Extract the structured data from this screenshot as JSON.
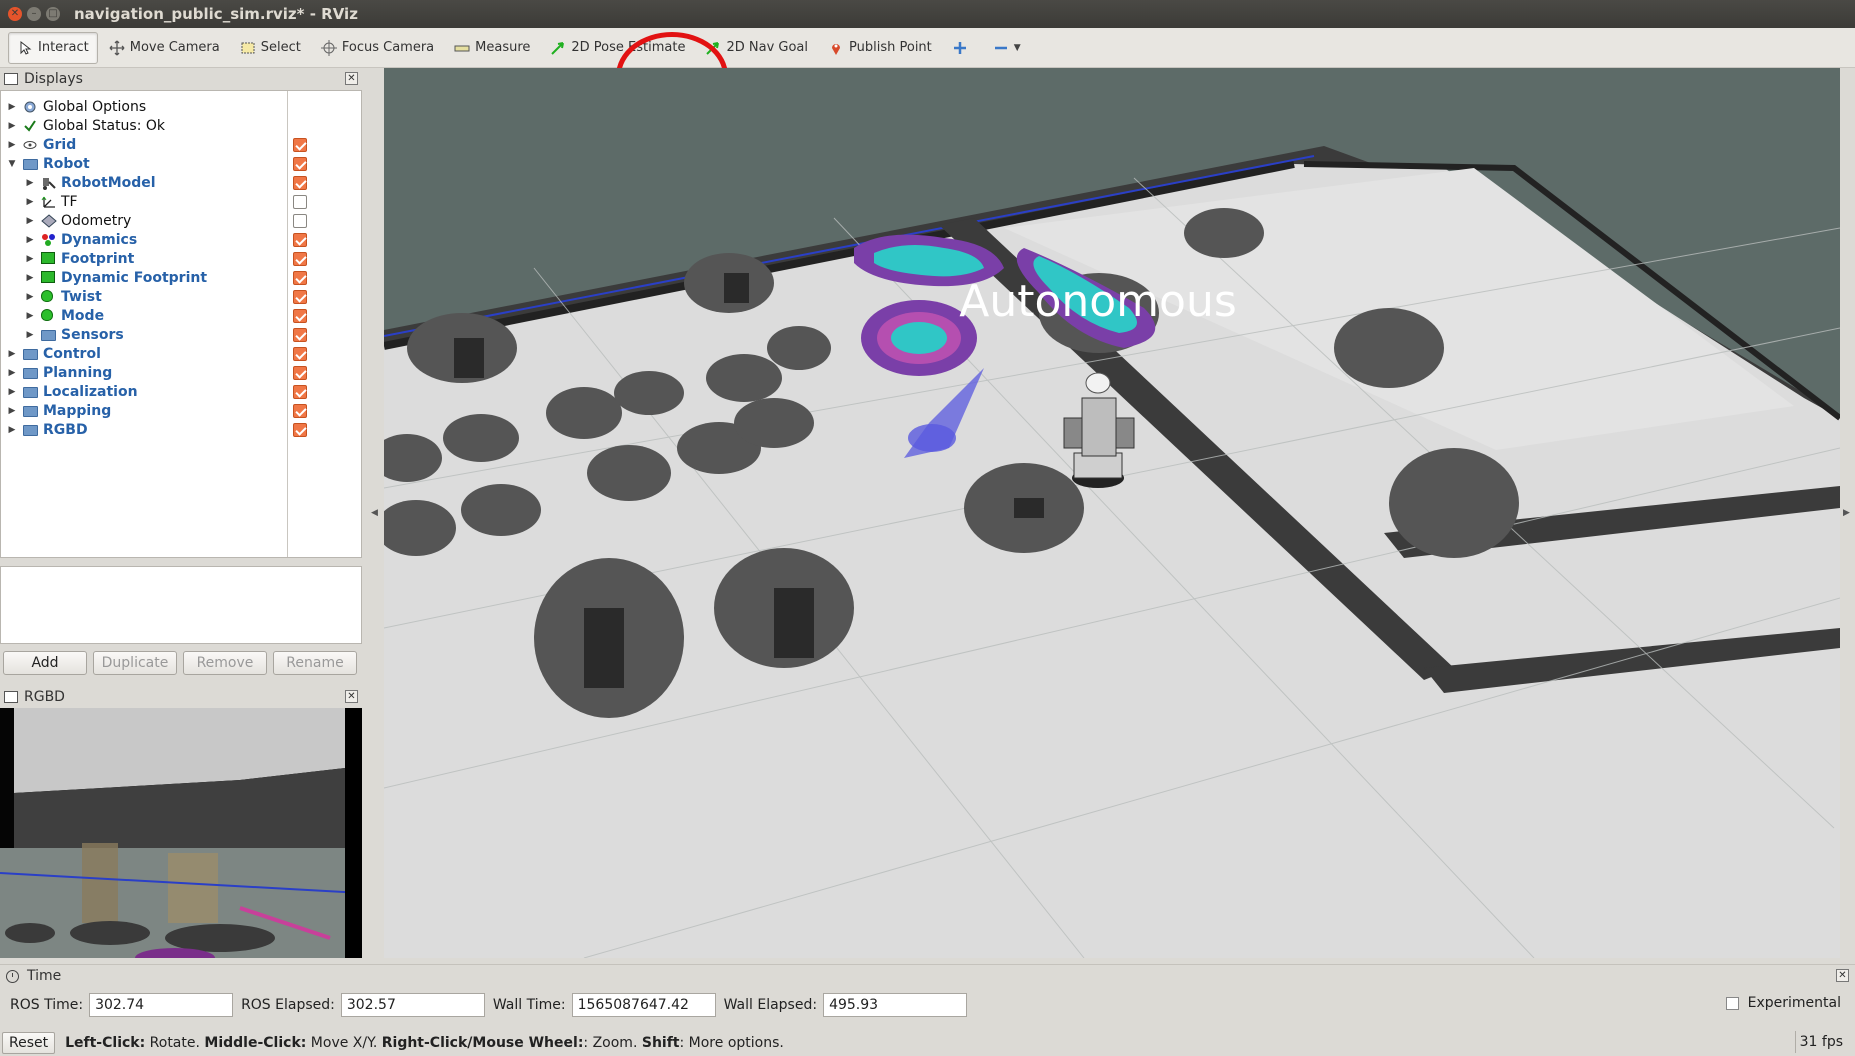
{
  "window": {
    "title": "navigation_public_sim.rviz* - RViz"
  },
  "toolbar": {
    "tools": [
      {
        "label": "Interact",
        "icon": "interact-cursor-icon",
        "active": true
      },
      {
        "label": "Move Camera",
        "icon": "move-camera-icon"
      },
      {
        "label": "Select",
        "icon": "select-box-icon"
      },
      {
        "label": "Focus Camera",
        "icon": "focus-crosshair-icon"
      },
      {
        "label": "Measure",
        "icon": "ruler-icon"
      },
      {
        "label": "2D Pose Estimate",
        "icon": "green-arrow-icon"
      },
      {
        "label": "2D Nav Goal",
        "icon": "green-arrow-icon"
      },
      {
        "label": "Publish Point",
        "icon": "map-pin-icon"
      }
    ],
    "highlight_color": "#e21212"
  },
  "displays": {
    "title": "Displays",
    "items": [
      {
        "label": "Global Options",
        "icon": "gear-icon",
        "bold": false,
        "checkbox": null
      },
      {
        "label": "Global Status: Ok",
        "icon": "checkmark-icon",
        "bold": false,
        "checkbox": null
      },
      {
        "label": "Grid",
        "icon": "grid-icon",
        "bold": true,
        "checkbox": true
      },
      {
        "label": "Robot",
        "icon": "folder-icon",
        "bold": true,
        "checkbox": true,
        "expanded": true
      },
      {
        "label": "RobotModel",
        "icon": "robot-model-icon",
        "bold": true,
        "checkbox": true
      },
      {
        "label": "TF",
        "icon": "tf-axes-icon",
        "bold": false,
        "checkbox": false
      },
      {
        "label": "Odometry",
        "icon": "odometry-icon",
        "bold": false,
        "checkbox": false
      },
      {
        "label": "Dynamics",
        "icon": "dynamics-icon",
        "bold": true,
        "checkbox": true
      },
      {
        "label": "Footprint",
        "icon": "footprint-icon",
        "bold": true,
        "checkbox": true
      },
      {
        "label": "Dynamic Footprint",
        "icon": "footprint-icon",
        "bold": true,
        "checkbox": true
      },
      {
        "label": "Twist",
        "icon": "twist-icon",
        "bold": true,
        "checkbox": true
      },
      {
        "label": "Mode",
        "icon": "mode-icon",
        "bold": true,
        "checkbox": true
      },
      {
        "label": "Sensors",
        "icon": "folder-icon",
        "bold": true,
        "checkbox": true
      },
      {
        "label": "Control",
        "icon": "folder-icon",
        "bold": true,
        "checkbox": true
      },
      {
        "label": "Planning",
        "icon": "folder-icon",
        "bold": true,
        "checkbox": true
      },
      {
        "label": "Localization",
        "icon": "folder-icon",
        "bold": true,
        "checkbox": true
      },
      {
        "label": "Mapping",
        "icon": "folder-icon",
        "bold": true,
        "checkbox": true
      },
      {
        "label": "RGBD",
        "icon": "folder-icon",
        "bold": true,
        "checkbox": true
      }
    ],
    "buttons": {
      "add": "Add",
      "duplicate": "Duplicate",
      "remove": "Remove",
      "rename": "Rename"
    }
  },
  "rgbd": {
    "title": "RGBD"
  },
  "viewport": {
    "overlay_text": "Autonomous"
  },
  "time": {
    "title": "Time",
    "ros_time_label": "ROS Time:",
    "ros_time": "302.74",
    "ros_elapsed_label": "ROS Elapsed:",
    "ros_elapsed": "302.57",
    "wall_time_label": "Wall Time:",
    "wall_time": "1565087647.42",
    "wall_elapsed_label": "Wall Elapsed:",
    "wall_elapsed": "495.93",
    "experimental_label": "Experimental"
  },
  "status": {
    "reset": "Reset",
    "hint": {
      "left_click": "Left-Click:",
      "left_click_action": " Rotate. ",
      "middle_click": "Middle-Click:",
      "middle_click_action": " Move X/Y. ",
      "right_click": "Right-Click/Mouse Wheel:",
      "right_click_action": ": Zoom. ",
      "shift": "Shift",
      "shift_action": ": More options."
    },
    "fps": "31 fps"
  }
}
